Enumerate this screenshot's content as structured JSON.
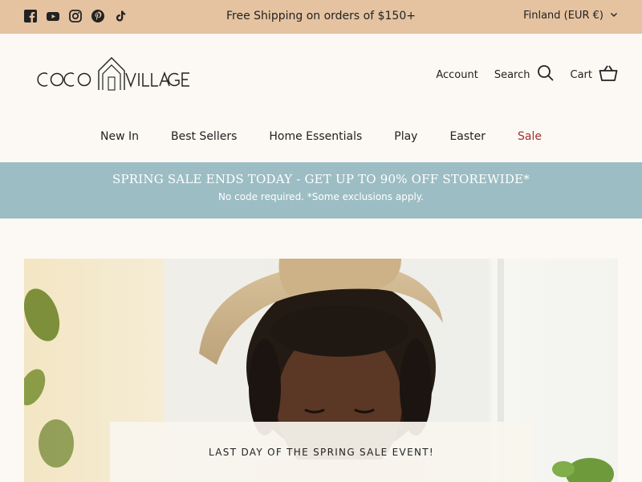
{
  "topbar": {
    "social_icons": [
      "facebook-icon",
      "youtube-icon",
      "instagram-icon",
      "pinterest-icon",
      "tiktok-icon"
    ],
    "message": "Free Shipping on orders of $150+",
    "country_selector": "Finland (EUR €)"
  },
  "header": {
    "logo_text": "COCO VILLAGE",
    "account_label": "Account",
    "search_label": "Search",
    "cart_label": "Cart"
  },
  "nav": {
    "items": [
      {
        "label": "New In"
      },
      {
        "label": "Best Sellers"
      },
      {
        "label": "Home Essentials"
      },
      {
        "label": "Play"
      },
      {
        "label": "Easter"
      },
      {
        "label": "Sale"
      }
    ]
  },
  "promo": {
    "title": "SPRING SALE ENDS TODAY - GET UP TO 90% OFF STOREWIDE*",
    "subtitle": "No code required. *Some exclusions apply."
  },
  "hero": {
    "card_title": "LAST DAY OF THE SPRING SALE EVENT!"
  },
  "colors": {
    "topbar_bg": "#e5c3a1",
    "page_bg": "#fcf8f3",
    "promo_bg": "#9cbdc3",
    "sale_accent": "#a0322d"
  }
}
